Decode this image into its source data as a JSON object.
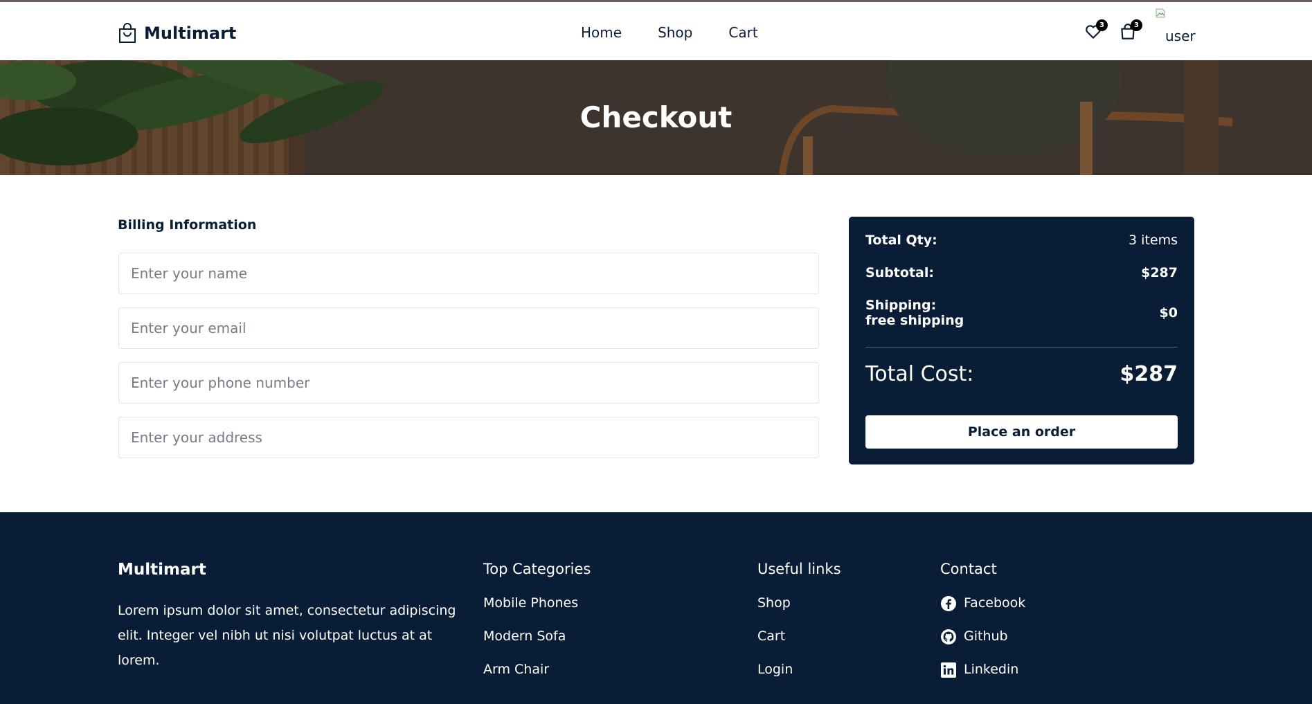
{
  "header": {
    "brand": "Multimart",
    "nav": [
      {
        "label": "Home"
      },
      {
        "label": "Shop"
      },
      {
        "label": "Cart"
      }
    ],
    "wishlist_count": "3",
    "cart_count": "3",
    "user_alt": "user"
  },
  "hero": {
    "title": "Checkout"
  },
  "billing": {
    "title": "Billing Information",
    "fields": [
      {
        "placeholder": "Enter your name",
        "value": ""
      },
      {
        "placeholder": "Enter your email",
        "value": ""
      },
      {
        "placeholder": "Enter your phone number",
        "value": ""
      },
      {
        "placeholder": "Enter your address",
        "value": ""
      }
    ]
  },
  "summary": {
    "qty_label": "Total Qty:",
    "qty_value": "3 items",
    "subtotal_label": "Subtotal:",
    "subtotal_value": "$287",
    "shipping_label": "Shipping:",
    "shipping_note": "free shipping",
    "shipping_value": "$0",
    "total_label": "Total Cost:",
    "total_value": "$287",
    "order_button": "Place an order"
  },
  "footer": {
    "brand": "Multimart",
    "description": "Lorem ipsum dolor sit amet, consectetur adipiscing elit. Integer vel nibh ut nisi volutpat luctus at at lorem.",
    "categories_title": "Top Categories",
    "categories": [
      "Mobile Phones",
      "Modern Sofa",
      "Arm Chair"
    ],
    "links_title": "Useful links",
    "links": [
      "Shop",
      "Cart",
      "Login"
    ],
    "contact_title": "Contact",
    "contact": [
      {
        "label": "Facebook",
        "icon": "facebook-icon"
      },
      {
        "label": "Github",
        "icon": "github-icon"
      },
      {
        "label": "Linkedin",
        "icon": "linkedin-icon"
      }
    ]
  },
  "colors": {
    "navy": "#0a1d37",
    "white": "#ffffff",
    "placeholder": "#747c86"
  }
}
